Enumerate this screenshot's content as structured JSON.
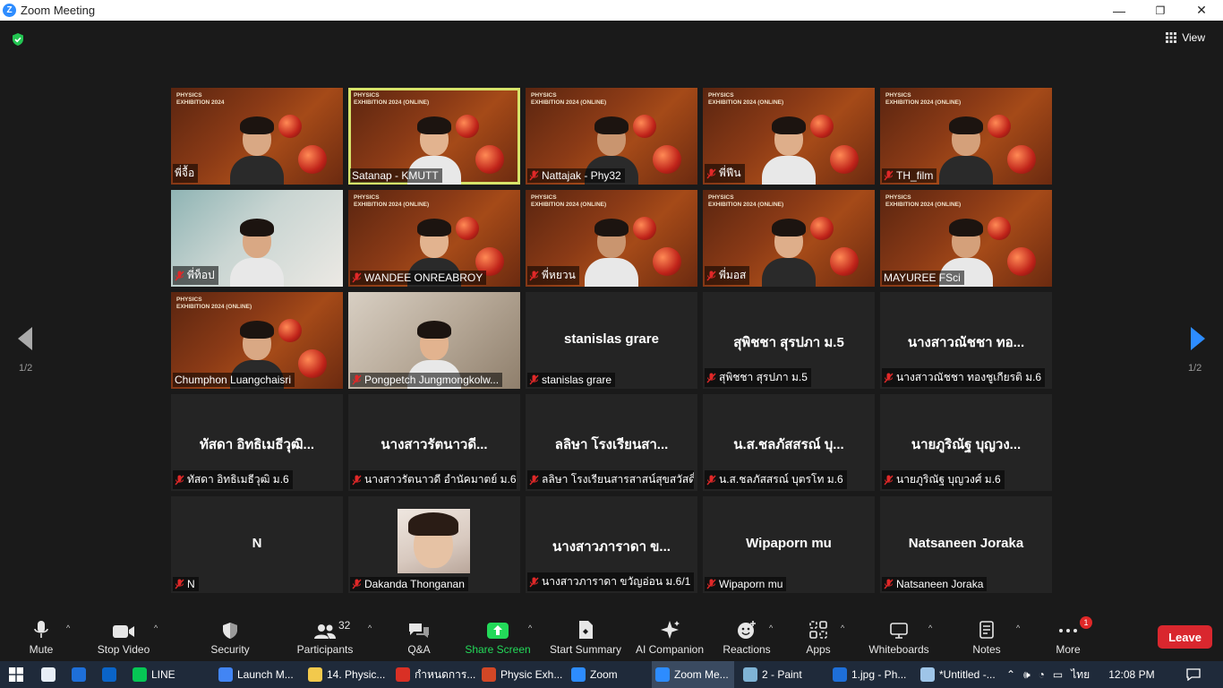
{
  "window": {
    "title": "Zoom Meeting",
    "minimize": "—",
    "maximize": "❐",
    "close": "✕"
  },
  "header": {
    "view_label": "View"
  },
  "pager": {
    "page_left": "1/2",
    "page_right": "1/2"
  },
  "tiles": [
    {
      "name": "พี่จื้อ",
      "kind": "video",
      "muted": false,
      "active": false,
      "banner": "PHYSICS\nEXHIBITION 2024"
    },
    {
      "name": "Satanap - KMUTT",
      "kind": "video",
      "muted": false,
      "active": true,
      "banner": "PHYSICS\nEXHIBITION 2024 (ONLINE)"
    },
    {
      "name": "Nattajak - Phy32",
      "kind": "video",
      "muted": true,
      "active": false,
      "banner": "PHYSICS\nEXHIBITION 2024 (ONLINE)"
    },
    {
      "name": "พี่ฟีน",
      "kind": "video",
      "muted": true,
      "active": false,
      "banner": "PHYSICS\nEXHIBITION 2024 (ONLINE)"
    },
    {
      "name": "TH_film",
      "kind": "video",
      "muted": true,
      "active": false,
      "banner": "PHYSICS\nEXHIBITION 2024 (ONLINE)"
    },
    {
      "name": "พี่ท็อป",
      "kind": "video-light",
      "muted": true,
      "active": false,
      "banner": ""
    },
    {
      "name": "WANDEE ONREABROY",
      "kind": "video",
      "muted": true,
      "active": false,
      "banner": "PHYSICS\nEXHIBITION 2024 (ONLINE)"
    },
    {
      "name": "พี่หยวน",
      "kind": "video",
      "muted": true,
      "active": false,
      "banner": "PHYSICS\nEXHIBITION 2024 (ONLINE)"
    },
    {
      "name": "พี่มอส",
      "kind": "video",
      "muted": true,
      "active": false,
      "banner": "PHYSICS\nEXHIBITION 2024 (ONLINE)"
    },
    {
      "name": "MAYUREE FSci",
      "kind": "video",
      "muted": false,
      "active": false,
      "banner": "PHYSICS\nEXHIBITION 2024 (ONLINE)"
    },
    {
      "name": "Chumphon Luangchaisri",
      "kind": "video",
      "muted": false,
      "active": false,
      "banner": "PHYSICS\nEXHIBITION 2024 (ONLINE)"
    },
    {
      "name": "Pongpetch Jungmongkolw...",
      "kind": "video-room",
      "muted": true,
      "active": false,
      "banner": ""
    },
    {
      "name": "stanislas grare",
      "display": "stanislas grare",
      "kind": "name",
      "muted": true,
      "active": false
    },
    {
      "name": "สุพิชชา สุรปภา ม.5",
      "display": "สุพิชชา สุรปภา ม.5",
      "kind": "name",
      "muted": true,
      "active": false
    },
    {
      "name": "นางสาวณัชชา ทองชูเกียรติ ม.6",
      "display": "นางสาวณัชชา ทอ...",
      "kind": "name",
      "muted": true,
      "active": false
    },
    {
      "name": "ทัสดา อิทธิเมธีวุฒิ ม.6",
      "display": "ทัสดา อิทธิเมธีวุฒิ...",
      "kind": "name",
      "muted": true,
      "active": false
    },
    {
      "name": "นางสาวรัตนาวดี อำนัคมาตย์ ม.6",
      "display": "นางสาวรัตนาวดี...",
      "kind": "name",
      "muted": true,
      "active": false
    },
    {
      "name": "ลลิษา โรงเรียนสารสาสน์สุขสวัสดิ์",
      "display": "ลลิษา โรงเรียนสา...",
      "kind": "name",
      "muted": true,
      "active": false
    },
    {
      "name": "น.ส.ชลภัสสรณ์ บุตรโท ม.6",
      "display": "น.ส.ชลภัสสรณ์ บุ...",
      "kind": "name",
      "muted": true,
      "active": false
    },
    {
      "name": "นายภูริณัฐ บุญวงศ์ ม.6",
      "display": "นายภูริณัฐ บุญวง...",
      "kind": "name",
      "muted": true,
      "active": false
    },
    {
      "name": "N",
      "display": "N",
      "kind": "name",
      "muted": true,
      "active": false
    },
    {
      "name": "Dakanda Thonganan",
      "kind": "avatar",
      "muted": true,
      "active": false
    },
    {
      "name": "นางสาวภาราดา ขวัญอ่อน ม.6/1",
      "display": "นางสาวภาราดา ข...",
      "kind": "name",
      "muted": true,
      "active": false
    },
    {
      "name": "Wipaporn mu",
      "display": "Wipaporn mu",
      "kind": "name",
      "muted": true,
      "active": false
    },
    {
      "name": "Natsaneen Joraka",
      "display": "Natsaneen Joraka",
      "kind": "name",
      "muted": true,
      "active": false
    }
  ],
  "toolbar": {
    "mute": "Mute",
    "stop_video": "Stop Video",
    "security": "Security",
    "participants": "Participants",
    "participants_count": "32",
    "qa": "Q&A",
    "share_screen": "Share Screen",
    "start_summary": "Start Summary",
    "ai_companion": "AI Companion",
    "reactions": "Reactions",
    "apps": "Apps",
    "whiteboards": "Whiteboards",
    "notes": "Notes",
    "more": "More",
    "more_badge": "1",
    "leave": "Leave"
  },
  "taskbar": {
    "items": [
      {
        "label": "LINE",
        "color": "#06c755"
      },
      {
        "label": "Launch M...",
        "color": "#4285f4"
      },
      {
        "label": "14. Physic...",
        "color": "#f2c94c"
      },
      {
        "label": "กำหนดการ...",
        "color": "#d93025"
      },
      {
        "label": "Physic Exh...",
        "color": "#d24726"
      },
      {
        "label": "Zoom",
        "color": "#2d8cff"
      },
      {
        "label": "Zoom Me...",
        "color": "#2d8cff"
      },
      {
        "label": "2 - Paint",
        "color": "#7fb3d5"
      },
      {
        "label": "1.jpg - Ph...",
        "color": "#1e6fd9"
      },
      {
        "label": "*Untitled -...",
        "color": "#9ec5e8"
      }
    ],
    "language": "ไทย",
    "clock": "12:08 PM"
  },
  "colors": {
    "active_speaker": "#d7e36a",
    "leave": "#d9272e",
    "share": "#23d959",
    "mute_red": "#e02828"
  }
}
